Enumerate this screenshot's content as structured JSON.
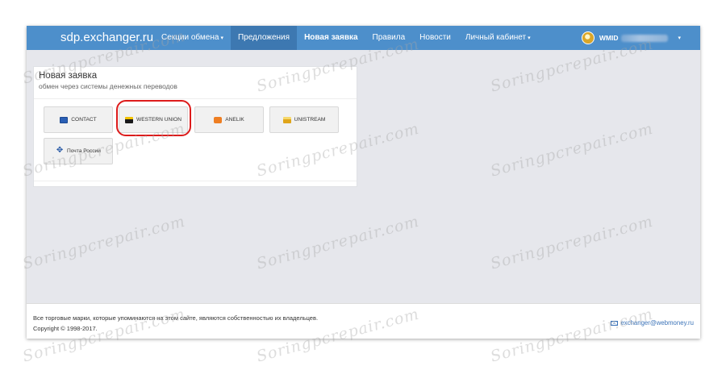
{
  "navbar": {
    "brand": "sdp.exchanger.ru",
    "items": [
      {
        "label": "Секции обмена",
        "caret": "▾"
      },
      {
        "label": "Предложения"
      },
      {
        "label": "Новая заявка"
      },
      {
        "label": "Правила"
      },
      {
        "label": "Новости"
      },
      {
        "label": "Личный кабинет",
        "caret": "▾"
      }
    ],
    "user": {
      "wmid_label": "WMID",
      "caret": "▾"
    }
  },
  "panel": {
    "title": "Новая заявка",
    "subtitle": "обмен через системы денежных переводов",
    "systems": [
      {
        "label": "CONTACT",
        "icon": "contact-logo-icon"
      },
      {
        "label": "WESTERN UNION",
        "icon": "western-union-logo-icon",
        "highlighted": true
      },
      {
        "label": "ANELIK",
        "icon": "anelik-logo-icon"
      },
      {
        "label": "UNISTREAM",
        "icon": "unistream-logo-icon"
      },
      {
        "label": "Почта России",
        "icon": "russian-post-logo-icon"
      }
    ]
  },
  "footer": {
    "trademark": "Все торговые марки, которые упоминаются на этом сайте, являются собственностью их владельцев.",
    "copyright": "Copyright © 1998-2017.",
    "email": "exchanger@webmoney.ru"
  },
  "watermark": {
    "text": "Soringpcrepair.com"
  },
  "colors": {
    "navbar": "#4d8fcb",
    "navbar_active": "#3d78b1",
    "background": "#e6e7ec",
    "highlight_circle": "#dd1b1b",
    "link": "#3b73b8"
  }
}
